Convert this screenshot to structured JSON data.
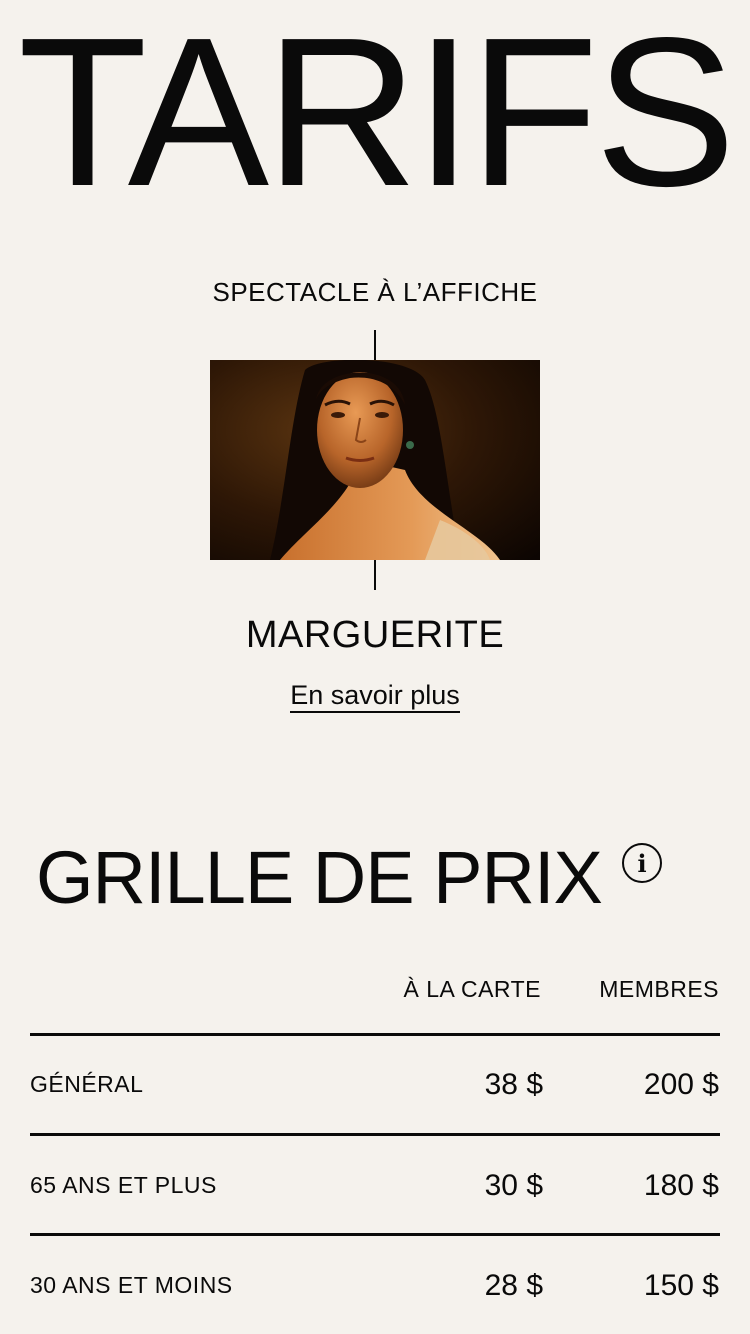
{
  "header": {
    "title": "TARIFS"
  },
  "featured": {
    "label": "SPECTACLE À L’AFFICHE",
    "show_title": "MARGUERITE",
    "learn_more": "En savoir plus"
  },
  "pricing": {
    "title": "GRILLE DE PRIX",
    "info_icon": "info-icon",
    "columns": [
      "À LA CARTE",
      "MEMBRES"
    ],
    "rows": [
      {
        "label": "GÉNÉRAL",
        "carte": "38 $",
        "membres": "200 $"
      },
      {
        "label": "65 ANS ET PLUS",
        "carte": "30 $",
        "membres": "180 $"
      },
      {
        "label": "30 ANS ET MOINS",
        "carte": "28 $",
        "membres": "150 $"
      }
    ]
  },
  "colors": {
    "background": "#f5f2ed",
    "text": "#0a0a0a"
  }
}
